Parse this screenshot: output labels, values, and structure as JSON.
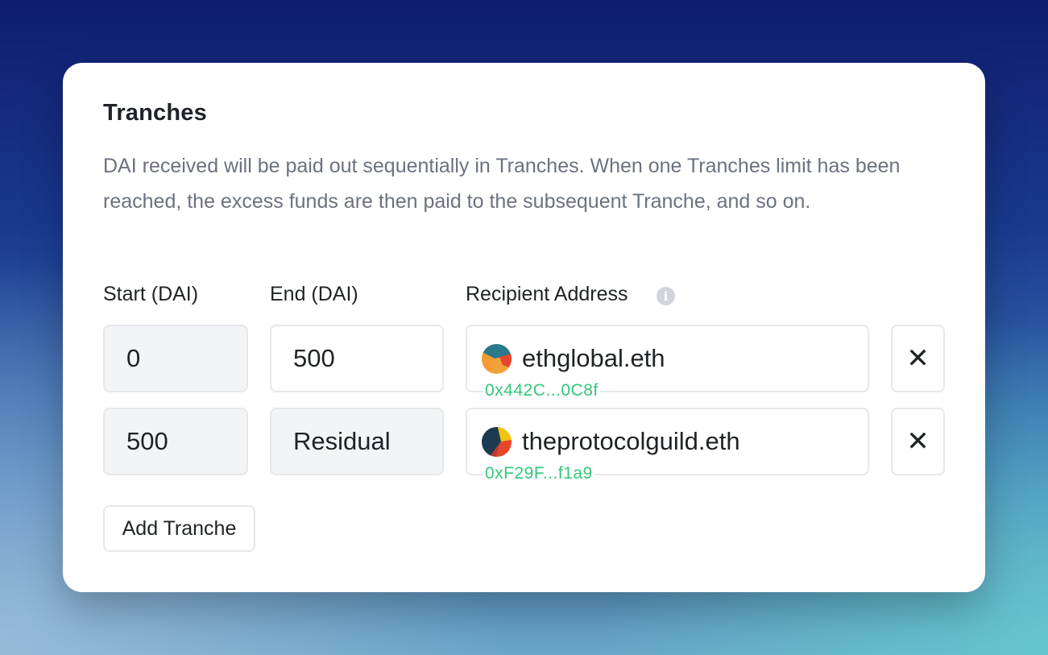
{
  "card": {
    "title": "Tranches",
    "description": "DAI received will be paid out sequentially in Tranches. When one Tranches limit has been reached, the excess funds are then paid to the subsequent Tranche, and so on."
  },
  "columns": {
    "start": "Start (DAI)",
    "end": "End (DAI)",
    "recipient": "Recipient Address",
    "info_icon": "info-icon"
  },
  "tranches": [
    {
      "start": "0",
      "end": "500",
      "ens": "ethglobal.eth",
      "address": "0x442C...0C8f",
      "remove_glyph": "✕"
    },
    {
      "start": "500",
      "end": "Residual",
      "ens": "theprotocolguild.eth",
      "address": "0xF29F...f1a9",
      "remove_glyph": "✕"
    }
  ],
  "actions": {
    "add_tranche": "Add Tranche"
  },
  "colors": {
    "address_green": "#34c77b",
    "readonly_bg": "#f3f4f6",
    "border": "#e5e7eb"
  }
}
